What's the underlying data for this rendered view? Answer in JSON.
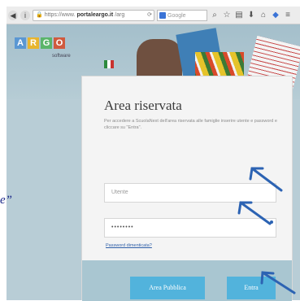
{
  "browser": {
    "url_prefix": "https://www.",
    "url_domain": "portaleargo.it",
    "url_suffix": "/arg",
    "search_placeholder": "Google"
  },
  "logo": {
    "letters": [
      "A",
      "R",
      "G",
      "O"
    ],
    "colors": [
      "#5a97d3",
      "#e8b52f",
      "#5ab56a",
      "#d05a3e"
    ],
    "subtitle": "software"
  },
  "login": {
    "title": "Area riservata",
    "description": "Per accedere a ScuolaNext dell'area riservata alle famiglie inserire utente e password e cliccare su \"Entra\".",
    "username_placeholder": "Utente",
    "password_value": "••••••••",
    "forgot_link": "Password dimenticata?",
    "public_button": "Area Pubblica",
    "enter_button": "Entra"
  },
  "overlay": {
    "fragment": "e”"
  },
  "colors": {
    "accent": "#52b3dc",
    "arrow": "#2c63b3"
  }
}
